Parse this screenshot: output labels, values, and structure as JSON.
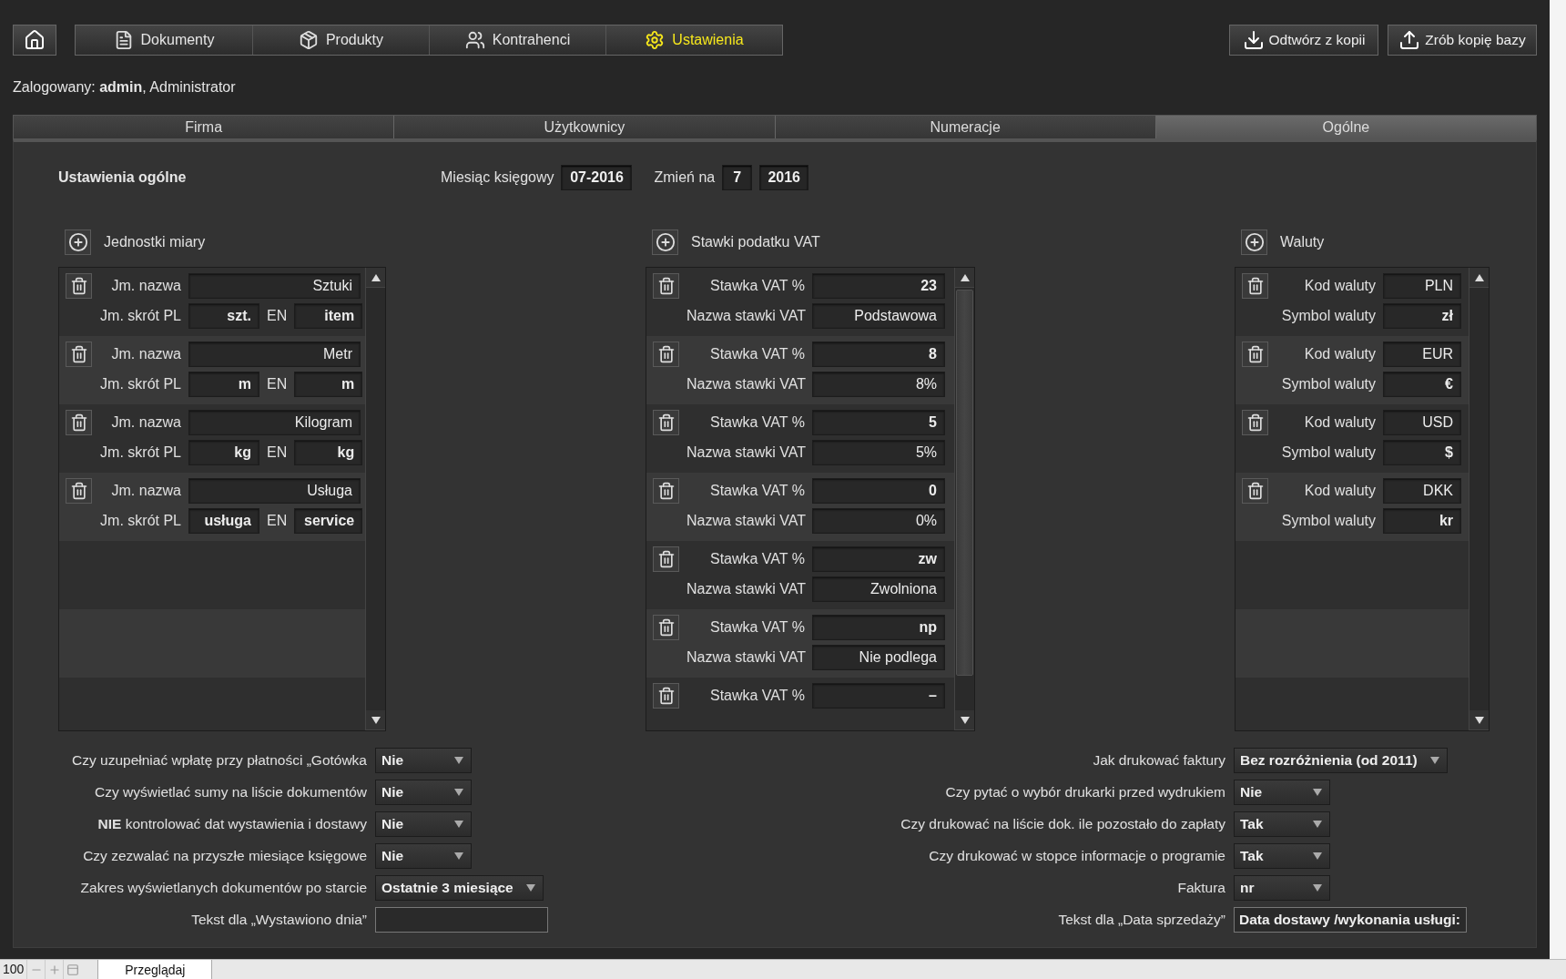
{
  "nav": {
    "items": [
      {
        "label": "Dokumenty",
        "kind": "documents",
        "selected": false
      },
      {
        "label": "Produkty",
        "kind": "products",
        "selected": false
      },
      {
        "label": "Kontrahenci",
        "kind": "contacts",
        "selected": false
      },
      {
        "label": "Ustawienia",
        "kind": "settings",
        "selected": true
      }
    ]
  },
  "actions": [
    {
      "label": "Odtwórz z kopii",
      "kind": "restore"
    },
    {
      "label": "Zrób kopię bazy",
      "kind": "backup"
    }
  ],
  "user_line": "Zalogowany: **admin**, Administrator",
  "tabs": [
    {
      "label": "Firma",
      "selected": false
    },
    {
      "label": "Użytkownicy",
      "selected": false
    },
    {
      "label": "Numeracje",
      "selected": false
    },
    {
      "label": "Ogólne",
      "selected": true
    }
  ],
  "title": "Ustawienia ogólne",
  "month": {
    "label": "Miesiąc księgowy",
    "value": "07-2016",
    "change_label": "Zmień na",
    "month_value": "7",
    "year_value": "2016"
  },
  "units": {
    "title": "Jednostki miary",
    "records": [
      {
        "name_label": "Jm. nazwa",
        "name": "Sztuki",
        "short_label": "Jm. skrót PL",
        "short_pl": "szt.",
        "en_label": "EN",
        "short_en": "item"
      },
      {
        "name_label": "Jm. nazwa",
        "name": "Metr",
        "short_label": "Jm. skrót PL",
        "short_pl": "m",
        "en_label": "EN",
        "short_en": "m"
      },
      {
        "name_label": "Jm. nazwa",
        "name": "Kilogram",
        "short_label": "Jm. skrót PL",
        "short_pl": "kg",
        "en_label": "EN",
        "short_en": "kg"
      },
      {
        "name_label": "Jm. nazwa",
        "name": "Usługa",
        "short_label": "Jm. skrót PL",
        "short_pl": "usługa",
        "en_label": "EN",
        "short_en": "service"
      }
    ]
  },
  "vat": {
    "title": "Stawki podatku VAT",
    "records": [
      {
        "rate_label": "Stawka VAT %",
        "rate": "23",
        "name_label": "Nazwa stawki VAT",
        "name": "Podstawowa"
      },
      {
        "rate_label": "Stawka VAT %",
        "rate": "8",
        "name_label": "Nazwa stawki VAT",
        "name": "8%"
      },
      {
        "rate_label": "Stawka VAT %",
        "rate": "5",
        "name_label": "Nazwa stawki VAT",
        "name": "5%"
      },
      {
        "rate_label": "Stawka VAT %",
        "rate": "0",
        "name_label": "Nazwa stawki VAT",
        "name": "0%"
      },
      {
        "rate_label": "Stawka VAT %",
        "rate": "zw",
        "name_label": "Nazwa stawki VAT",
        "name": "Zwolniona"
      },
      {
        "rate_label": "Stawka VAT %",
        "rate": "np",
        "name_label": "Nazwa stawki VAT",
        "name": "Nie podlega"
      },
      {
        "rate_label": "Stawka VAT %",
        "rate": "–"
      }
    ]
  },
  "currencies": {
    "title": "Waluty",
    "records": [
      {
        "code_label": "Kod waluty",
        "code": "PLN",
        "symbol_label": "Symbol waluty",
        "symbol": "zł"
      },
      {
        "code_label": "Kod waluty",
        "code": "EUR",
        "symbol_label": "Symbol waluty",
        "symbol": "€"
      },
      {
        "code_label": "Kod waluty",
        "code": "USD",
        "symbol_label": "Symbol waluty",
        "symbol": "$"
      },
      {
        "code_label": "Kod waluty",
        "code": "DKK",
        "symbol_label": "Symbol waluty",
        "symbol": "kr"
      }
    ]
  },
  "settings_left": [
    {
      "label": "Czy uzupełniać wpłatę przy płatności „Gotówka",
      "kind": "select",
      "value": "Nie"
    },
    {
      "label": "Czy wyświetlać sumy na liście dokumentów",
      "kind": "select",
      "value": "Nie"
    },
    {
      "label": "**NIE** kontrolować dat wystawienia i dostawy",
      "kind": "select",
      "value": "Nie"
    },
    {
      "label": "Czy zezwalać na przyszłe miesiące księgowe",
      "kind": "select",
      "value": "Nie"
    },
    {
      "label": "Zakres wyświetlanych dokumentów po starcie",
      "kind": "select",
      "value": "Ostatnie 3 miesiące"
    },
    {
      "label": "Tekst dla „Wystawiono dnia”",
      "kind": "text"
    }
  ],
  "settings_right": [
    {
      "label": "Jak drukować faktury",
      "kind": "select",
      "value": "Bez rozróżnienia (od 2011)"
    },
    {
      "label": "Czy pytać o wybór drukarki przed wydrukiem",
      "kind": "select",
      "value": "Nie"
    },
    {
      "label": "Czy drukować na liście dok. ile pozostało do zapłaty",
      "kind": "select",
      "value": "Tak"
    },
    {
      "label": "Czy drukować w stopce informacje o programie",
      "kind": "select",
      "value": "Tak"
    },
    {
      "label": "Faktura",
      "kind": "select",
      "value": "nr"
    },
    {
      "label": "Tekst dla „Data sprzedaży”",
      "kind": "text",
      "value": "Data dostawy /wykonania usługi:"
    }
  ],
  "status_bar": {
    "zoom": "100",
    "mode": "Przeglądaj"
  }
}
